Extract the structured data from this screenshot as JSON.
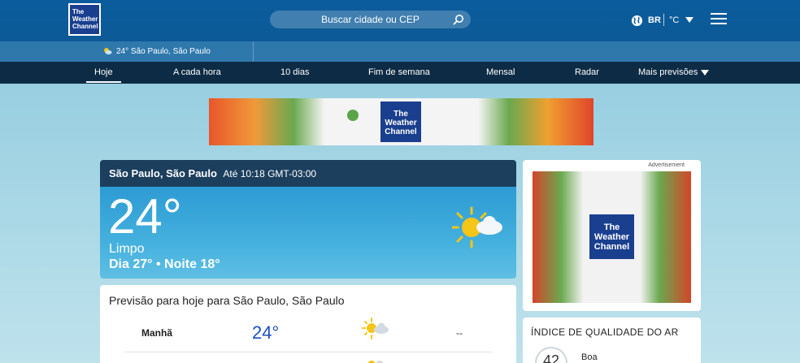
{
  "header": {
    "logo_text": "The Weather Channel",
    "search_placeholder": "Buscar cidade ou CEP",
    "language": "BR",
    "unit": "°C"
  },
  "location_strip": {
    "text": "24° São Paulo, São Paulo"
  },
  "nav": {
    "tabs": [
      {
        "label": "Hoje",
        "active": true
      },
      {
        "label": "A cada hora"
      },
      {
        "label": "10 dias"
      },
      {
        "label": "Fim de semana"
      },
      {
        "label": "Mensal"
      },
      {
        "label": "Radar"
      },
      {
        "label": "Mais previsões"
      }
    ]
  },
  "top_ad": {
    "logo_text": "The Weather Channel"
  },
  "current": {
    "location": "São Paulo, São Paulo",
    "time": "Até 10:18 GMT-03:00",
    "temperature": "24°",
    "phrase": "Limpo",
    "hilo": "Dia 27° • Noite 18°",
    "icon": "mostly-sunny-icon"
  },
  "right_ad": {
    "label": "Advertisement",
    "logo_text": "The Weather Channel"
  },
  "today_forecast": {
    "title": "Previsão para hoje para São Paulo, São Paulo",
    "rows": [
      {
        "label": "Manhã",
        "temp": "24°",
        "precip": "--"
      }
    ]
  },
  "air_quality": {
    "title": "ÍNDICE DE QUALIDADE DO AR",
    "value": "42",
    "status": "Boa"
  },
  "colors": {
    "header_bg": "#0a5c9c",
    "nav_bg": "#0d2b45",
    "card_head_bg": "#1c3f5e",
    "temp_accent": "#1a4fbf"
  }
}
